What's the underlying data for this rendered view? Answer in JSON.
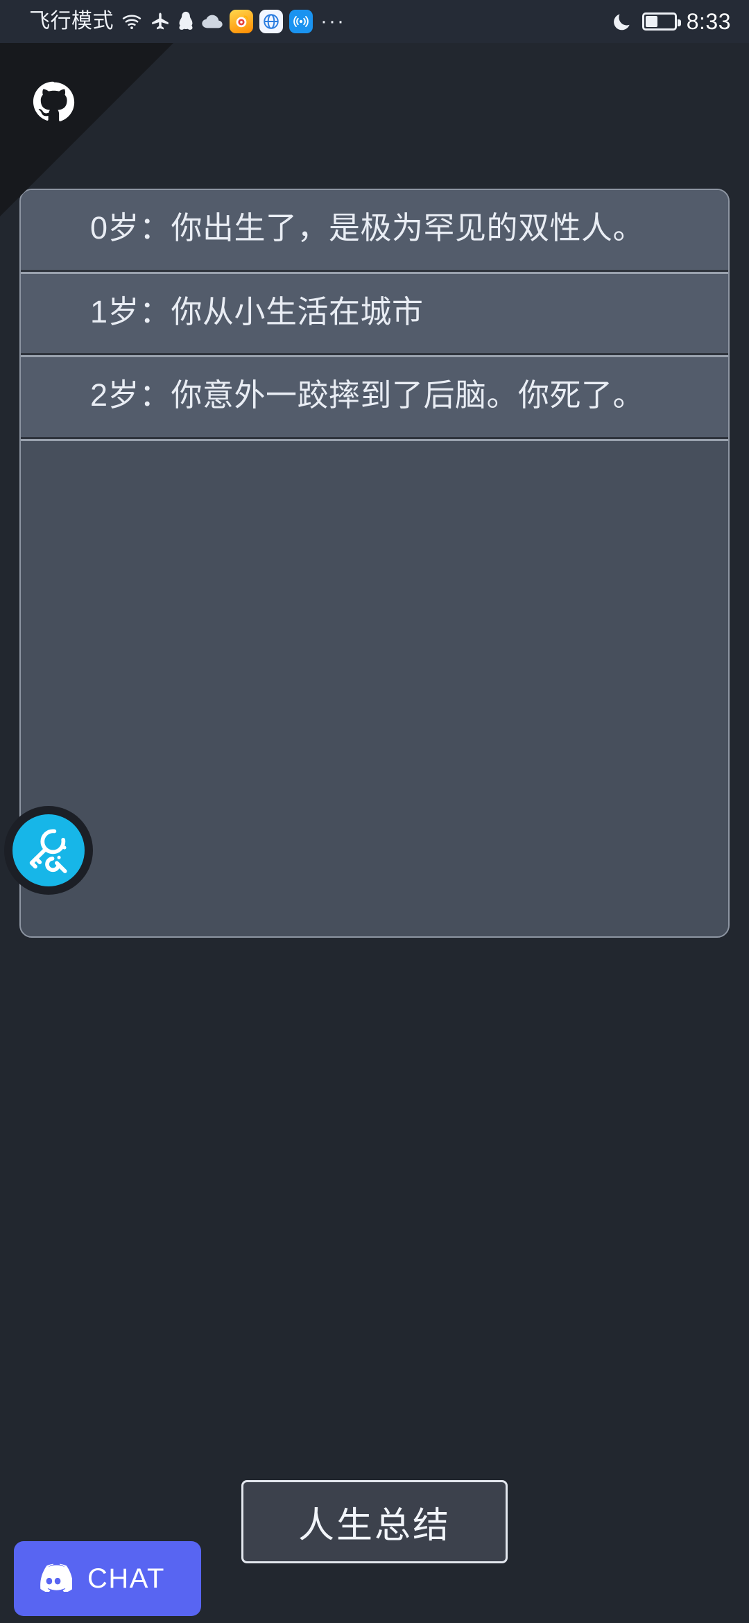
{
  "status_bar": {
    "carrier_text": "飞行模式",
    "time": "8:33",
    "battery_percent": 40,
    "icons": [
      {
        "name": "wifi-icon"
      },
      {
        "name": "airplane-icon"
      },
      {
        "name": "qq-penguin-icon"
      },
      {
        "name": "cloud-icon"
      },
      {
        "name": "weibo-icon"
      },
      {
        "name": "browser-globe-icon"
      },
      {
        "name": "hotspot-icon"
      }
    ],
    "overflow": "···",
    "do_not_disturb_icon": "moon-icon"
  },
  "corner_ribbon": {
    "icon": "github-octocat-icon",
    "background": "#17191d"
  },
  "life_log": {
    "entries": [
      "0岁：你出生了，是极为罕见的双性人。",
      "1岁：你从小生活在城市",
      "2岁：你意外一跤摔到了后脑。你死了。"
    ]
  },
  "fab": {
    "icon": "key-wrench-icon",
    "color": "#17b6e8"
  },
  "buttons": {
    "summary_label": "人生总结",
    "discord_label": "CHAT",
    "discord_color": "#5865f2"
  },
  "colors": {
    "page_background": "#22272f",
    "status_bar_background": "#252b36",
    "panel_background": "#474f5c",
    "panel_row_background": "#535c6b",
    "panel_border": "#8e96a3",
    "text_primary": "#e9edf4",
    "accent_cyan": "#17b6e8"
  }
}
